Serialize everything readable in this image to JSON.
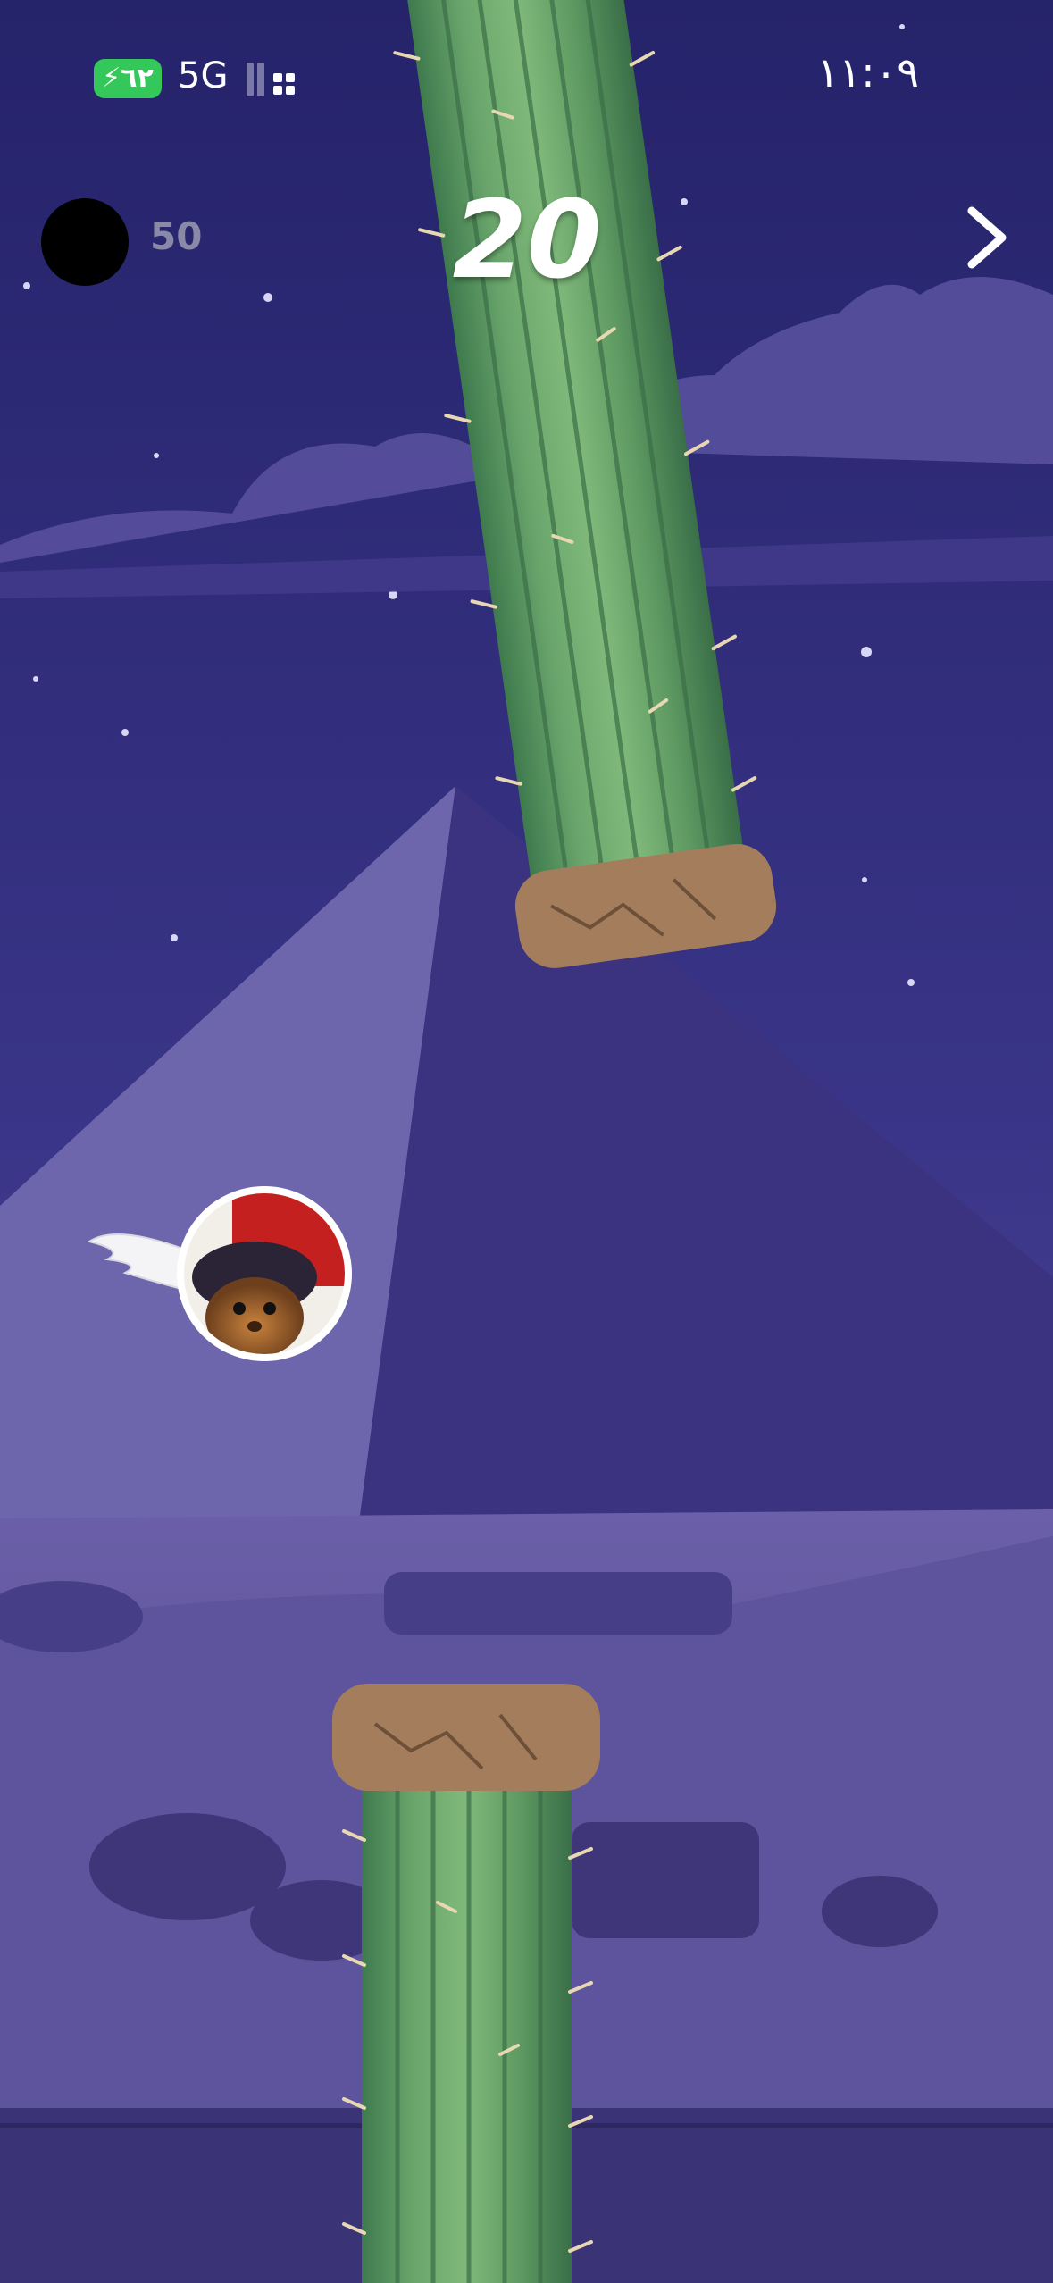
{
  "status_bar": {
    "battery_label": "⚡٦٢",
    "network": "5G",
    "time": "١١:٠٩"
  },
  "hud": {
    "coins": "50",
    "score": "20"
  },
  "colors": {
    "sky": "#2c2a6e",
    "cactus": "#6aa36a",
    "battery": "#34c759"
  },
  "icons": {
    "next": "chevron-right-icon",
    "coin": "coin-icon",
    "signal": "signal-icon"
  }
}
